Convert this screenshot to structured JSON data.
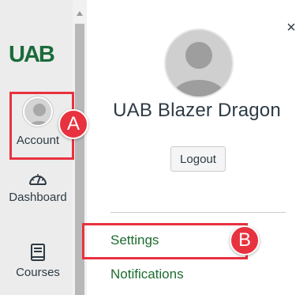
{
  "brand": {
    "logo_text": "UAB",
    "logo_color": "#1b6b3a"
  },
  "global_nav": {
    "items": [
      {
        "label": "Account",
        "icon": "user-avatar-icon"
      },
      {
        "label": "Dashboard",
        "icon": "speedometer-icon"
      },
      {
        "label": "Courses",
        "icon": "book-icon"
      }
    ]
  },
  "account_tray": {
    "user_name": "UAB Blazer Dragon",
    "close_label": "×",
    "logout_label": "Logout",
    "links": [
      {
        "label": "Settings"
      },
      {
        "label": "Notifications"
      }
    ],
    "link_color": "#1d6b2f"
  },
  "annotations": {
    "callout_a": "A",
    "callout_b": "B",
    "color": "#e8323f"
  }
}
